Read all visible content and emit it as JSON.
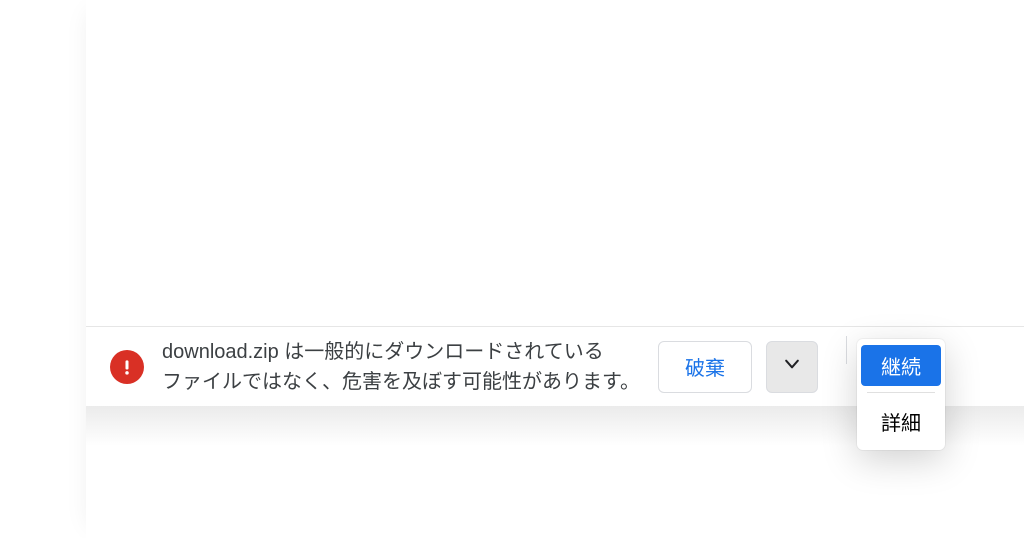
{
  "download": {
    "filename": "download.zip",
    "warning_line1_suffix": " は一般的にダウンロードされている",
    "warning_line2": "ファイルではなく、危害を及ぼす可能性があります。",
    "discard_label": "破棄"
  },
  "menu": {
    "continue_label": "継続",
    "details_label": "詳細"
  },
  "icons": {
    "warning": "warning-icon",
    "chevron": "chevron-down-icon"
  },
  "colors": {
    "danger": "#d93025",
    "link": "#1a73e8"
  }
}
